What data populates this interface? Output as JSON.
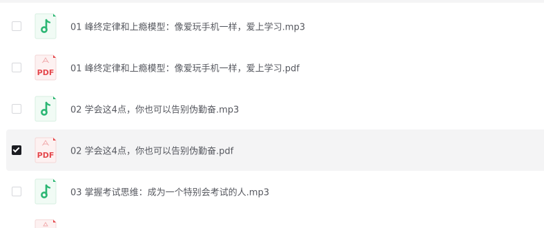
{
  "files": [
    {
      "name": "01 峰终定律和上瘾模型：像爱玩手机一样，爱上学习.mp3",
      "type": "mp3",
      "icon": "music-note-icon",
      "checked": false
    },
    {
      "name": "01 峰终定律和上瘾模型：像爱玩手机一样，爱上学习.pdf",
      "type": "pdf",
      "icon": "pdf-file-icon",
      "checked": false
    },
    {
      "name": "02 学会这4点，你也可以告别伪勤奋.mp3",
      "type": "mp3",
      "icon": "music-note-icon",
      "checked": false
    },
    {
      "name": "02 学会这4点，你也可以告别伪勤奋.pdf",
      "type": "pdf",
      "icon": "pdf-file-icon",
      "checked": true
    },
    {
      "name": "03 掌握考试思维：成为一个特别会考试的人.mp3",
      "type": "mp3",
      "icon": "music-note-icon",
      "checked": false
    }
  ],
  "icon_labels": {
    "pdf": "PDF"
  },
  "colors": {
    "mp3_accent": "#2bb673",
    "pdf_accent": "#e5484d",
    "selected_row_bg": "#f4f4f5",
    "checkbox_checked": "#1b1c21"
  }
}
